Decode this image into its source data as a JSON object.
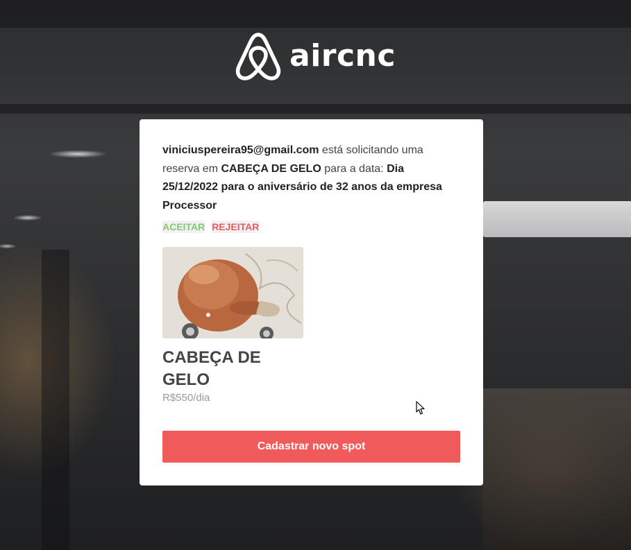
{
  "app": {
    "brand_name": "aircnc",
    "logo_icon": "airbnb-belo-icon",
    "accent_color": "#f05a5b"
  },
  "booking_request": {
    "requester_email": "viniciuspereira95@gmail.com",
    "text_requesting": " está solicitando uma reserva em ",
    "spot_name": "CABEÇA DE GELO",
    "text_for_date": " para a data: ",
    "date_description": "Dia 25/12/2022 para o aniversário de 32 anos da empresa Processor",
    "accept_label": "ACEITAR",
    "reject_label": "REJEITAR",
    "accept_color": "#84c870",
    "reject_color": "#e55e5e"
  },
  "spot": {
    "thumbnail": "spot-photo",
    "title": "CABEÇA DE GELO",
    "price": "R$550/dia"
  },
  "primary_action": {
    "label": "Cadastrar novo spot"
  }
}
